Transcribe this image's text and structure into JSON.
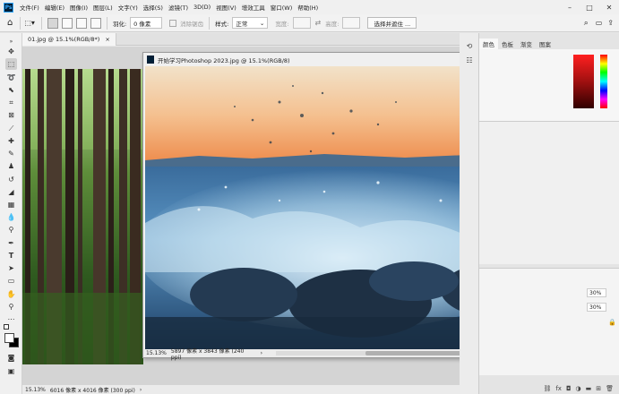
{
  "menubar": {
    "items": [
      "文件(F)",
      "编辑(E)",
      "图像(I)",
      "图层(L)",
      "文字(Y)",
      "选择(S)",
      "滤镜(T)",
      "3D(D)",
      "视图(V)",
      "增效工具",
      "窗口(W)",
      "帮助(H)"
    ],
    "logo": "Ps"
  },
  "optbar": {
    "feather_label": "羽化:",
    "feather_value": "0 像素",
    "antialias_label": "消除锯齿",
    "style_label": "样式:",
    "style_value": "正常",
    "width_label": "宽度:",
    "height_label": "高度:",
    "select_subject_label": "选择并遮住 ..."
  },
  "doc_tab": {
    "name": "01.jpg @ 15.1%(RGB/8*)",
    "close": "×"
  },
  "status": {
    "zoom": "15.13%",
    "info": "6016 像素 x 4016 像素 (300 ppi)"
  },
  "float_window": {
    "title": "开始学习Photoshop 2023.jpg @ 15.1%(RGB/8)",
    "zoom": "15.13%",
    "info": "5897 像素 x 3843 像素 (240 ppi)"
  },
  "panel": {
    "tabs": [
      "颜色",
      "色板",
      "渐变",
      "图案"
    ],
    "opacity_values": [
      "30%",
      "30%"
    ]
  },
  "colors": {
    "foreground": "#ffffff",
    "background": "#000000",
    "accent": "#31a8ff"
  }
}
